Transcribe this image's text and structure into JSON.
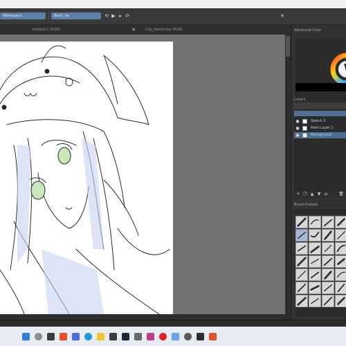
{
  "toolbar": {
    "workspace_label": "Workspace...",
    "brush_preset_label": "Basic_tip",
    "undo_icon": "undo-icon",
    "redo_icon": "redo-icon"
  },
  "tabs": [
    {
      "label": "Untitled 1 (RGB)"
    },
    {
      "label": "Clip_sketch.kra (RGB)"
    }
  ],
  "dock": {
    "color_title": "Advanced Color",
    "layers_title": "Layers",
    "brush_title": "Brush Presets",
    "layers": [
      {
        "name": "Sketch 2",
        "selected": false
      },
      {
        "name": "Paint Layer 1",
        "selected": false
      },
      {
        "name": "Background",
        "selected": true
      }
    ],
    "layer_tool_icons": [
      "add-icon",
      "duplicate-icon",
      "up-icon",
      "down-icon",
      "properties-icon",
      "delete-icon"
    ]
  },
  "colors": {
    "accent": "#5b7fa8",
    "canvas_bg": "#727272",
    "panel_bg": "#323232",
    "selection": "#4b6d94"
  },
  "taskbar": {
    "icons": [
      "windows-icon",
      "search-icon",
      "task-view-icon",
      "brave-icon",
      "app-icon",
      "edge-icon",
      "explorer-icon",
      "store-icon",
      "steam-icon",
      "settings-icon",
      "mail-icon",
      "red-app-icon",
      "krita-icon",
      "gear-icon",
      "media-icon",
      "game-icon"
    ]
  }
}
